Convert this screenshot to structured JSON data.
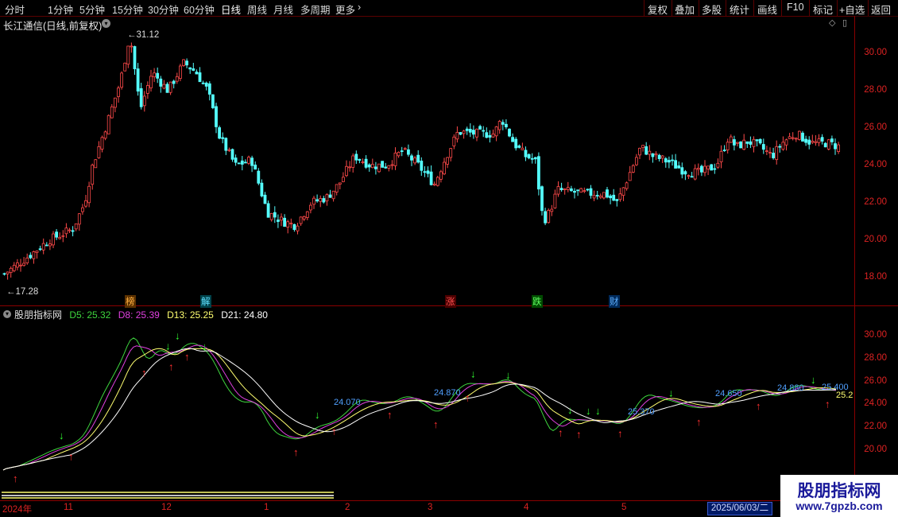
{
  "toolbar": {
    "timeframes": [
      "分时",
      "1分钟",
      "5分钟",
      "15分钟",
      "30分钟",
      "60分钟",
      "日线",
      "周线",
      "月线",
      "多周期",
      "更多"
    ],
    "active_timeframe": "日线",
    "buttons": [
      "复权",
      "叠加",
      "多股",
      "统计",
      "画线",
      "F10",
      "标记",
      "+自选",
      "返回"
    ]
  },
  "stock": {
    "title": "长江通信(日线,前复权)"
  },
  "price_chart": {
    "y_ticks": [
      "30.00",
      "28.00",
      "26.00",
      "24.00",
      "22.00",
      "20.00",
      "18.00"
    ],
    "high_label": "31.12",
    "low_label": "17.28",
    "events": [
      {
        "label": "榜",
        "color": "#e8a040"
      },
      {
        "label": "解",
        "color": "#40c8e8"
      },
      {
        "label": "涨",
        "color": "#ff4040"
      },
      {
        "label": "跌",
        "color": "#40e040"
      },
      {
        "label": "财",
        "color": "#40a0ff"
      }
    ]
  },
  "indicator": {
    "name": "股朋指标网",
    "d5": "D5: 25.32",
    "d8": "D8: 25.39",
    "d13": "D13: 25.25",
    "d21": "D21: 24.80",
    "y_ticks": [
      "30.00",
      "28.00",
      "26.00",
      "24.00",
      "22.00",
      "20.00"
    ],
    "price_tags": [
      "24.070",
      "24.870",
      "24.650",
      "25.370",
      "24.880",
      "25.400",
      "25.2"
    ]
  },
  "x_axis": {
    "labels": [
      "2024年",
      "11",
      "12",
      "1",
      "2",
      "3",
      "4",
      "5"
    ],
    "cursor_date": "2025/06/03/二"
  },
  "watermark": {
    "title": "股朋指标网",
    "url": "www.7gpzb.com"
  },
  "colors": {
    "up": "#ff4a4a",
    "down": "#54ffff",
    "d5": "#3ed63e",
    "d8": "#e040e0",
    "d13": "#ffff70",
    "d21": "#ffffff",
    "grid": "#5a0000"
  }
}
